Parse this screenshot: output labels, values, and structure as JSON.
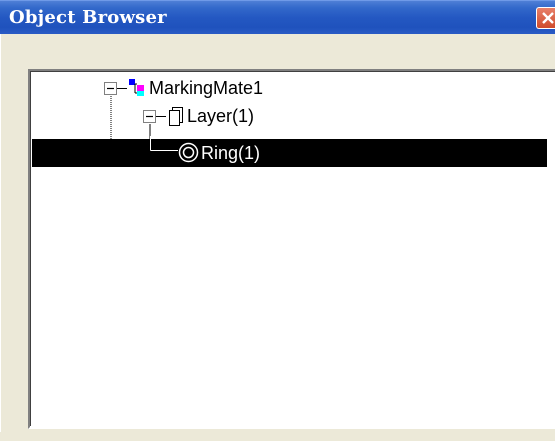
{
  "window": {
    "title": "Object Browser"
  },
  "tree": {
    "items": [
      {
        "label": "MarkingMate1",
        "level": 0,
        "expanded": true,
        "icon": "project-icon",
        "selected": false
      },
      {
        "label": "Layer(1)",
        "level": 1,
        "expanded": true,
        "icon": "layer-icon",
        "selected": false
      },
      {
        "label": "Ring(1)",
        "level": 2,
        "expanded": false,
        "icon": "ring-icon",
        "selected": true
      }
    ]
  },
  "colors": {
    "titlebar": "#2458c2",
    "close_button": "#cf4b2b",
    "selection": "#000000",
    "panel": "#ece9d8"
  }
}
